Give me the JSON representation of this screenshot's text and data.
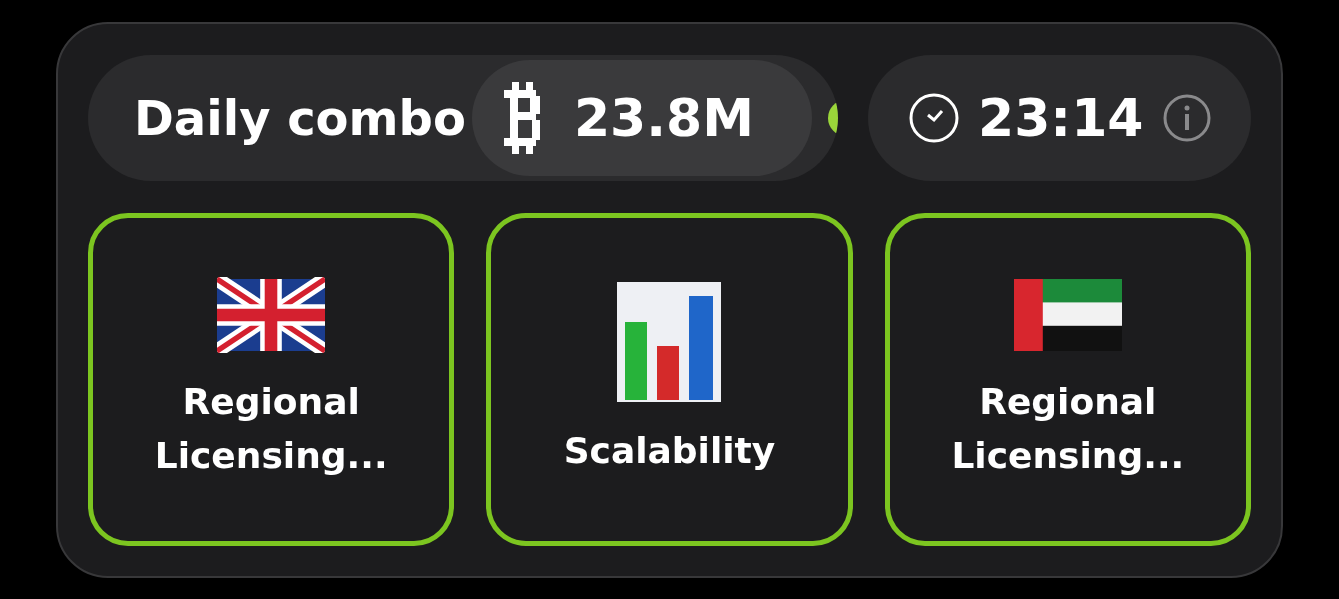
{
  "header": {
    "title": "Daily combo",
    "reward": "23.8M",
    "timer": "23:14"
  },
  "cards": [
    {
      "kind": "uk_flag",
      "label": "Regional Licensing...",
      "found": true
    },
    {
      "kind": "chart",
      "label": "Scalability",
      "found": true
    },
    {
      "kind": "uae_flag",
      "label": "Regional Licensing...",
      "found": true
    }
  ]
}
